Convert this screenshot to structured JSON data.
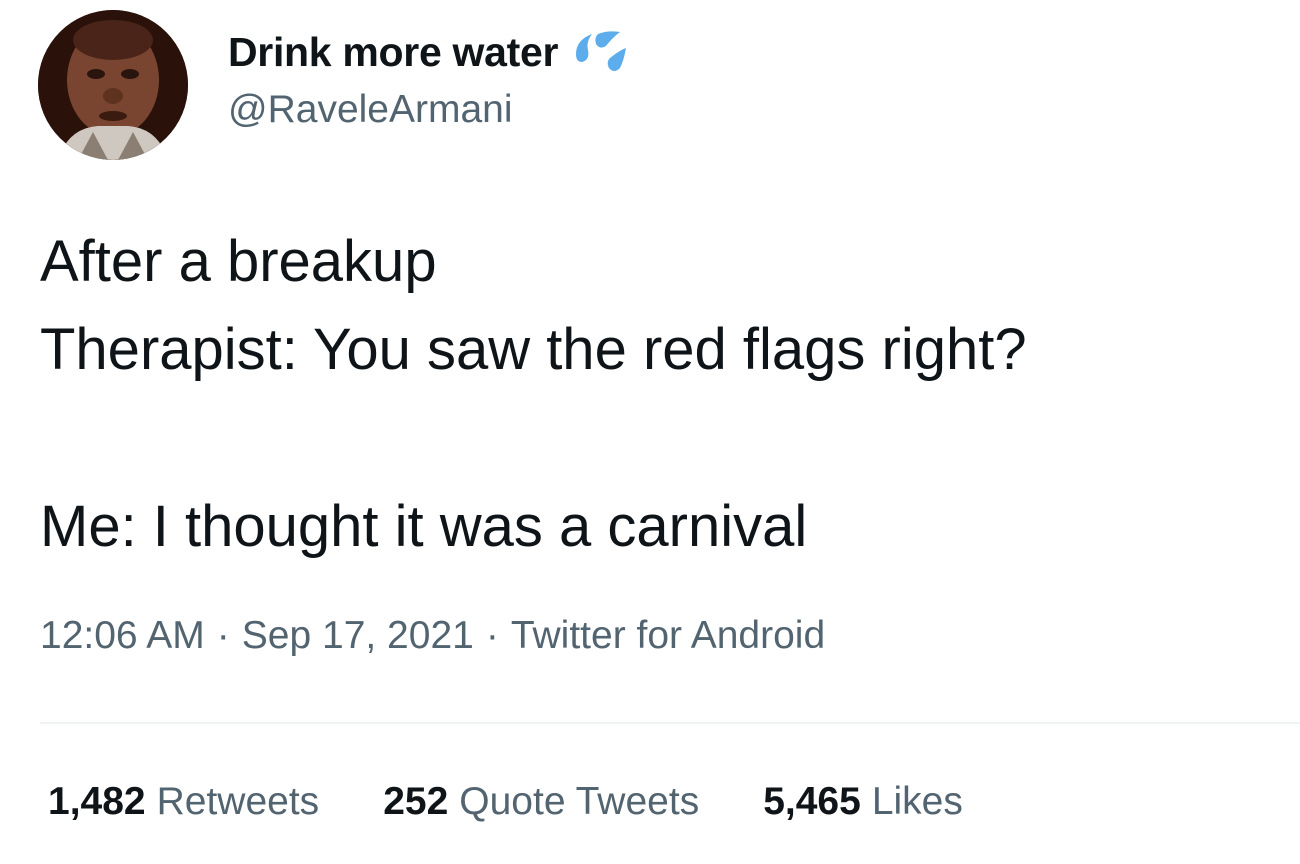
{
  "tweet": {
    "author": {
      "display_name": "Drink more water",
      "name_emoji": "sweat-droplets-icon",
      "handle": "@RaveleArmani"
    },
    "text_lines": [
      "After a breakup",
      "Therapist: You saw the red flags right?",
      "",
      "Me: I thought it was a carnival"
    ],
    "meta": {
      "time": "12:06 AM",
      "separator": "·",
      "date": "Sep 17, 2021",
      "source": "Twitter for Android"
    },
    "stats": [
      {
        "count": "1,482",
        "label": "Retweets"
      },
      {
        "count": "252",
        "label": "Quote Tweets"
      },
      {
        "count": "5,465",
        "label": "Likes"
      }
    ]
  },
  "colors": {
    "text_primary": "#0f1419",
    "text_secondary": "#536471",
    "divider": "#eff3f4",
    "emoji_blue": "#5dadec"
  }
}
